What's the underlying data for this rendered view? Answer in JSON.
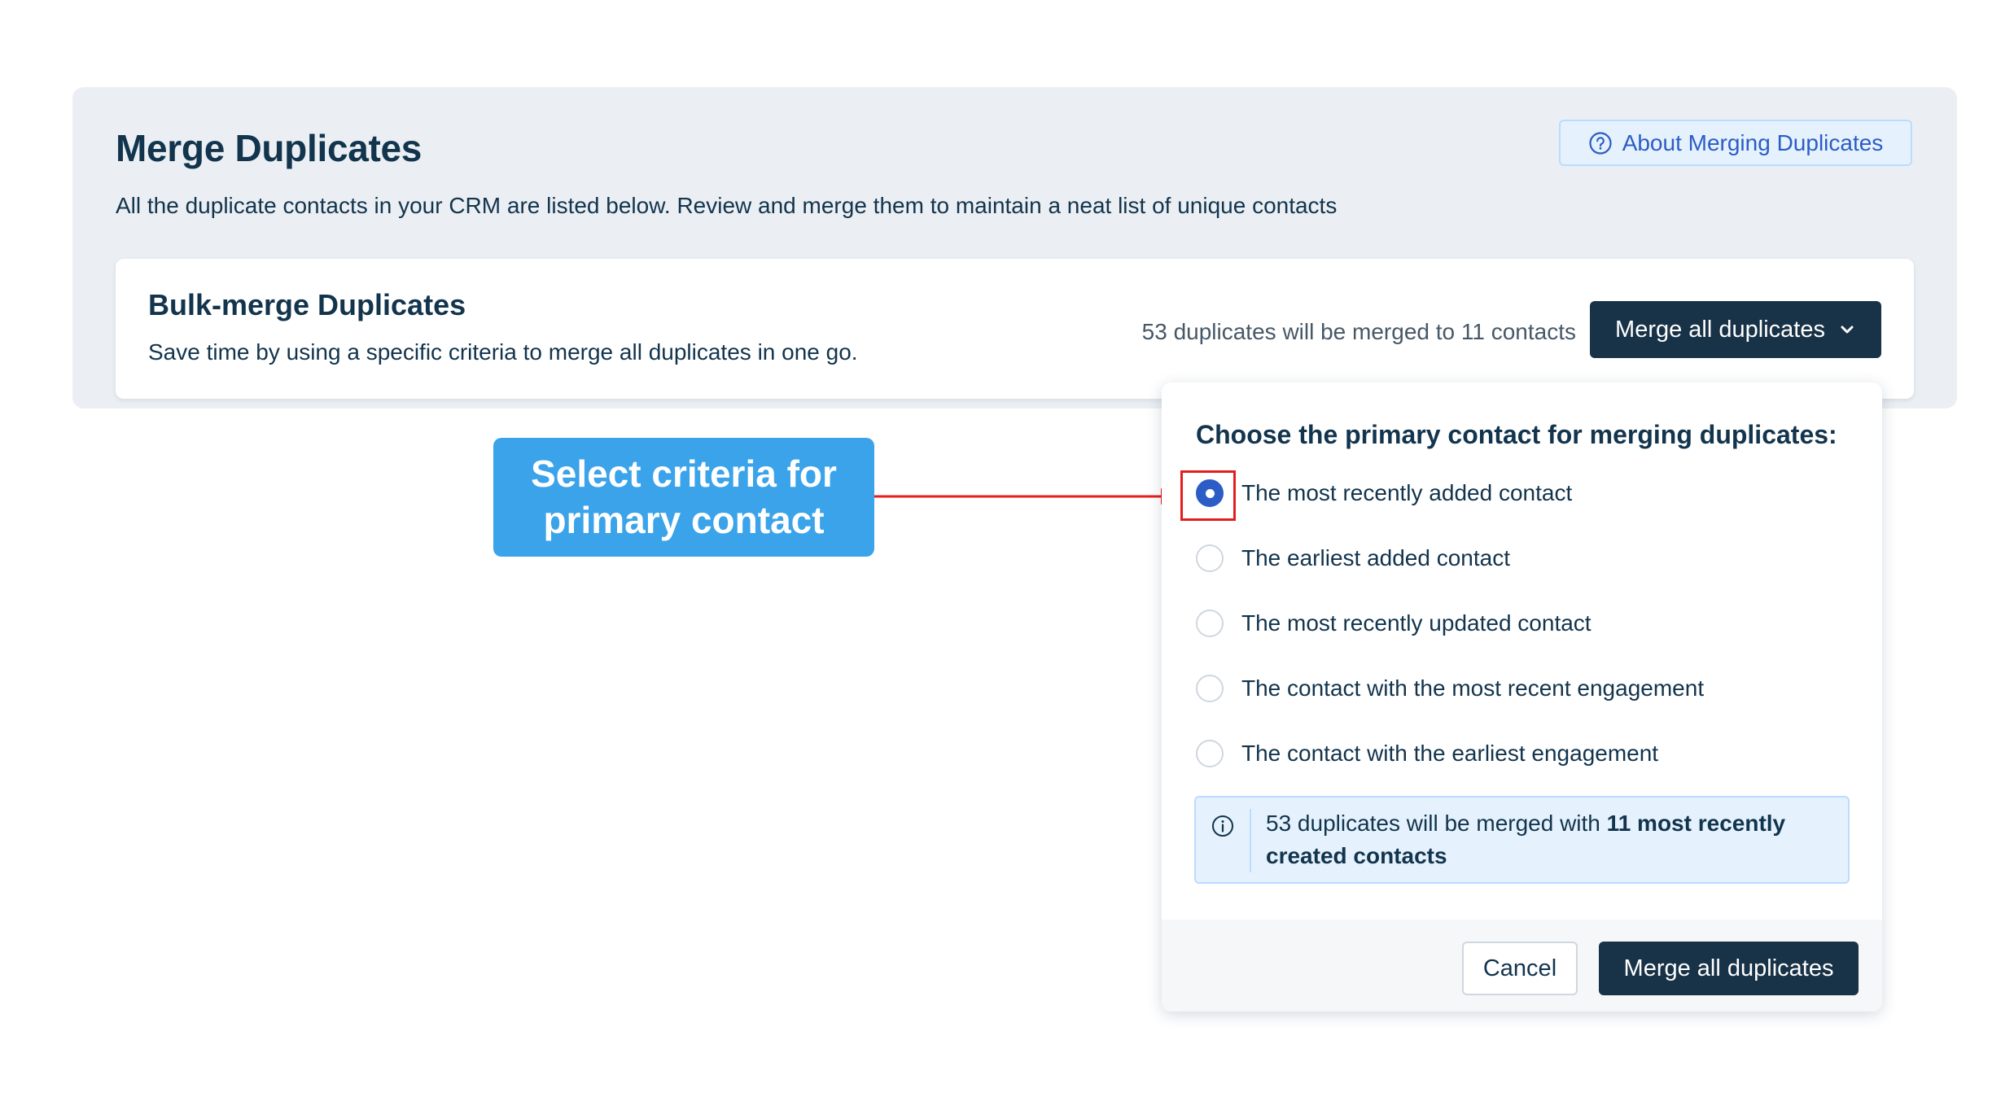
{
  "page": {
    "title": "Merge Duplicates",
    "description": "All the duplicate contacts in your CRM are listed below. Review and merge them to maintain a neat list of unique contacts",
    "about_button": "About Merging Duplicates",
    "about_icon": "question-circle-icon"
  },
  "bulk": {
    "title": "Bulk-merge Duplicates",
    "description": "Save time by using a specific criteria to merge all duplicates in one go.",
    "summary": "53 duplicates will be merged to 11 contacts",
    "merge_button": "Merge all duplicates",
    "merge_button_icon": "chevron-down-icon"
  },
  "callout": {
    "line1": "Select criteria for",
    "line2": "primary contact",
    "color": "#3ba3ea",
    "arrow_color": "#e41e1e"
  },
  "dropdown": {
    "heading": "Choose the primary contact for merging duplicates:",
    "options": [
      {
        "label": "The most recently added contact",
        "selected": true
      },
      {
        "label": "The earliest added contact",
        "selected": false
      },
      {
        "label": "The most recently updated contact",
        "selected": false
      },
      {
        "label": "The contact with the most recent engagement",
        "selected": false
      },
      {
        "label": "The contact with the earliest engagement",
        "selected": false
      }
    ],
    "info": {
      "icon": "info-circle-icon",
      "text_prefix": "53 duplicates will be merged with ",
      "text_bold": "11 most recently created contacts"
    },
    "cancel_button": "Cancel",
    "confirm_button": "Merge all duplicates"
  },
  "colors": {
    "primary_dark": "#183247",
    "accent_blue": "#2c5cc5",
    "info_bg": "#e5f2fd",
    "panel_bg": "#ebeff3"
  }
}
